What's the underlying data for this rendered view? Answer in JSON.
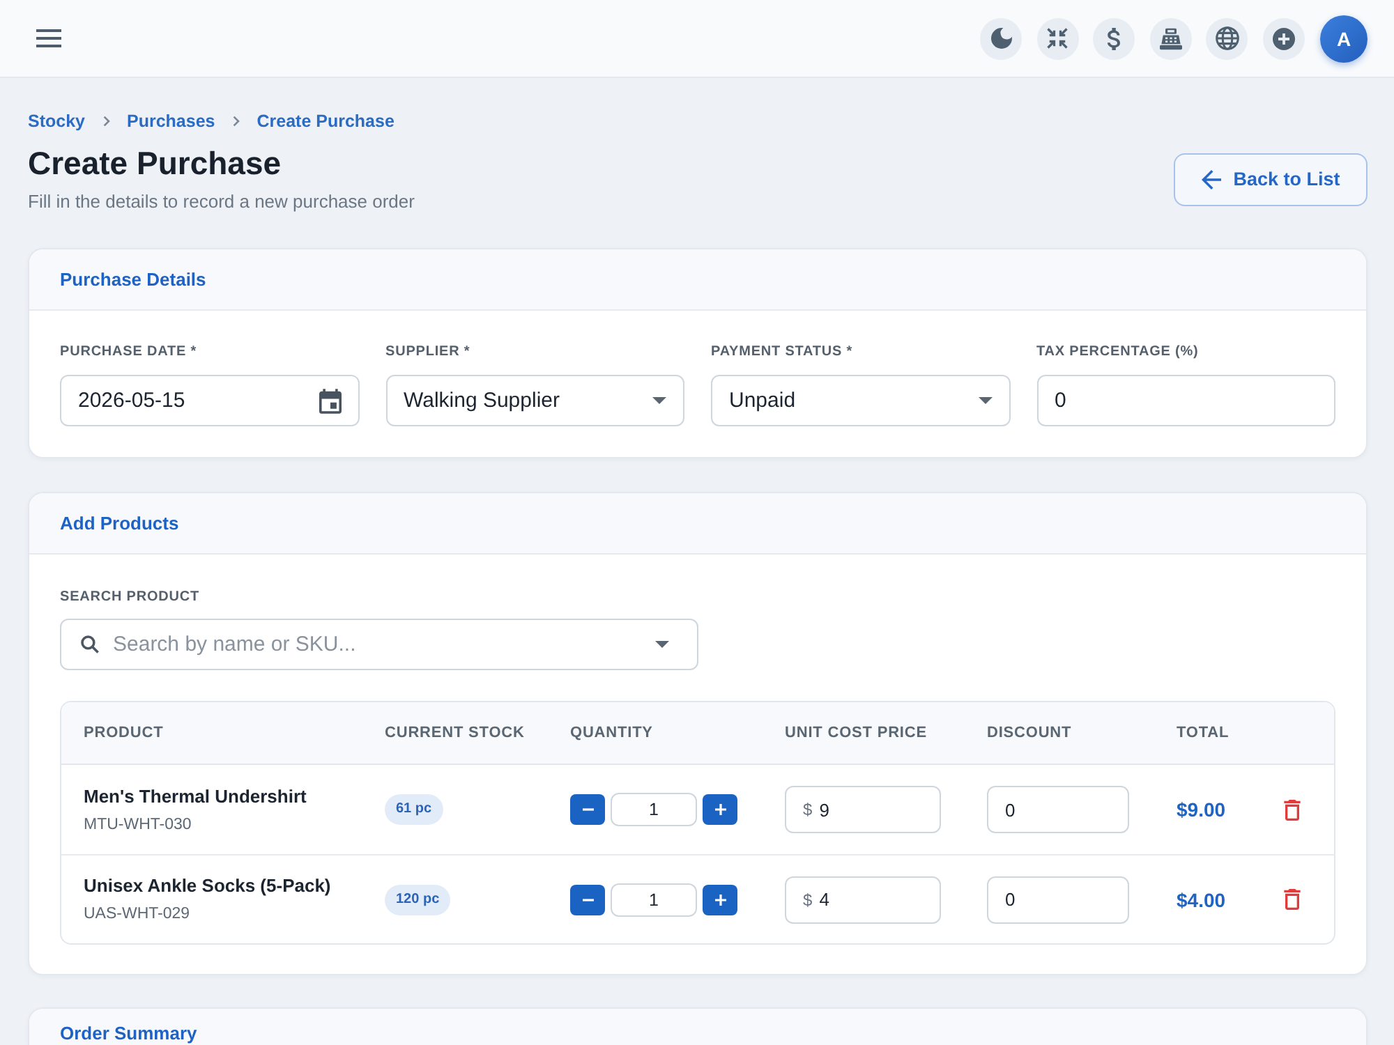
{
  "top_bar": {
    "avatar_initial": "A"
  },
  "breadcrumb": [
    "Stocky",
    "Purchases",
    "Create Purchase"
  ],
  "header": {
    "title": "Create Purchase",
    "subtitle": "Fill in the details to record a new purchase order",
    "back_button": "Back to List"
  },
  "purchase_details": {
    "title": "Purchase Details",
    "fields": [
      {
        "kind": "date",
        "label": "PURCHASE DATE *",
        "value": "2026-05-15"
      },
      {
        "kind": "select",
        "label": "SUPPLIER *",
        "value": "Walking Supplier"
      },
      {
        "kind": "select",
        "label": "PAYMENT STATUS *",
        "value": "Unpaid"
      },
      {
        "kind": "text",
        "label": "TAX PERCENTAGE (%)",
        "value": "0"
      }
    ]
  },
  "add_products": {
    "title": "Add Products",
    "search": {
      "label": "SEARCH PRODUCT",
      "placeholder": "Search by name or SKU..."
    },
    "table": {
      "columns": [
        "PRODUCT",
        "CURRENT STOCK",
        "QUANTITY",
        "UNIT COST PRICE",
        "DISCOUNT",
        "TOTAL"
      ],
      "rows": [
        {
          "name": "Men's Thermal Undershirt",
          "sku": "MTU-WHT-030",
          "stock": "61 pc",
          "quantity": "1",
          "currency": "$",
          "unit_cost": "9",
          "discount": "0",
          "total": "$9.00"
        },
        {
          "name": "Unisex Ankle Socks (5-Pack)",
          "sku": "UAS-WHT-029",
          "stock": "120 pc",
          "quantity": "1",
          "currency": "$",
          "unit_cost": "4",
          "discount": "0",
          "total": "$4.00"
        }
      ]
    }
  },
  "order_summary": {
    "title": "Order Summary"
  }
}
